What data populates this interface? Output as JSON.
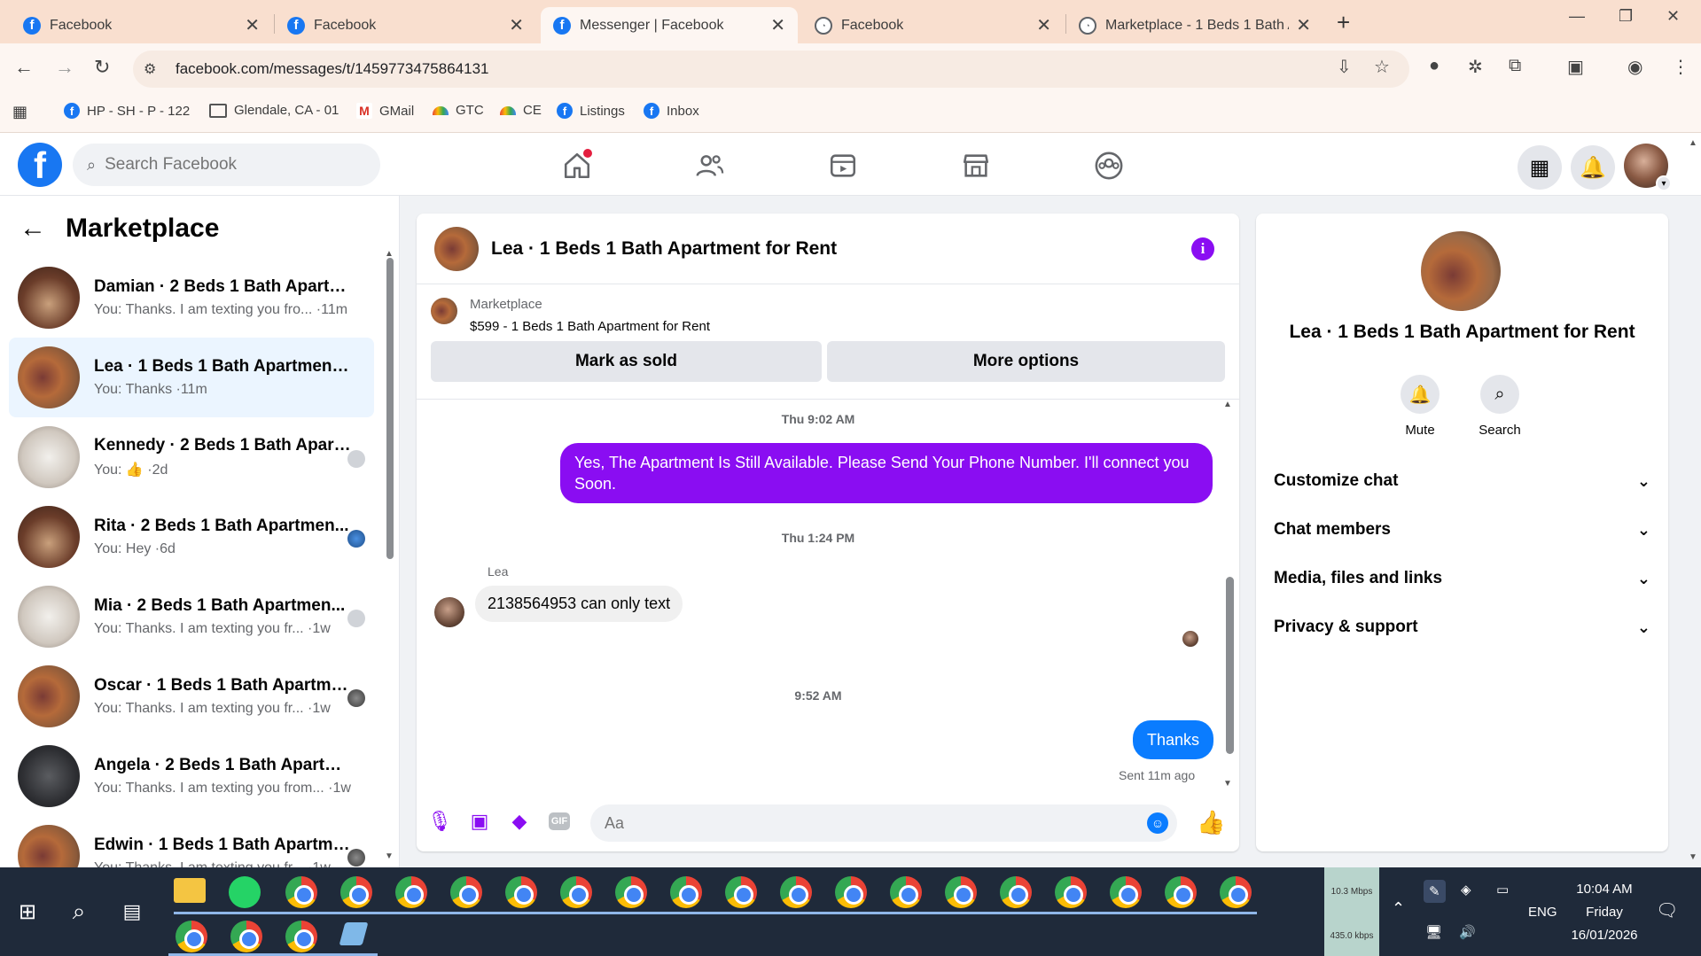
{
  "browser": {
    "tabs": [
      {
        "label": "Facebook",
        "icon": "facebook-icon"
      },
      {
        "label": "Facebook",
        "icon": "facebook-icon"
      },
      {
        "label": "Messenger | Facebook",
        "icon": "facebook-icon"
      },
      {
        "label": "Facebook",
        "icon": "loading-icon"
      },
      {
        "label": "Marketplace - 1 Beds 1 Bath Ap",
        "icon": "loading-icon"
      }
    ],
    "url": "facebook.com/messages/t/1459773475864131",
    "bookmarks": [
      {
        "label": "HP - SH - P - 122",
        "icon": "facebook-icon"
      },
      {
        "label": "Glendale, CA - 01",
        "icon": "folder-icon"
      },
      {
        "label": "GMail",
        "icon": "gmail-icon"
      },
      {
        "label": "GTC",
        "icon": "rainbow-icon"
      },
      {
        "label": "CE",
        "icon": "rainbow-icon"
      },
      {
        "label": "Listings",
        "icon": "facebook-icon"
      },
      {
        "label": "Inbox",
        "icon": "facebook-icon"
      }
    ]
  },
  "fb": {
    "search_placeholder": "Search Facebook",
    "brand_color": "#1877f2"
  },
  "left": {
    "title": "Marketplace",
    "conversations": [
      {
        "name": "Damian · 2 Beds 1 Bath Apartme...",
        "preview": "You: Thanks. I am texting you fro... ·11m"
      },
      {
        "name": "Lea · 1 Beds 1 Bath Apartment fo...",
        "preview": "You: Thanks ·11m"
      },
      {
        "name": "Kennedy · 2 Beds 1 Bath Apart...",
        "preview": "You: 👍 ·2d"
      },
      {
        "name": "Rita · 2 Beds 1 Bath Apartmen...",
        "preview": "You: Hey ·6d"
      },
      {
        "name": "Mia · 2 Beds 1 Bath Apartmen...",
        "preview": "You: Thanks. I am texting you fr... ·1w"
      },
      {
        "name": "Oscar · 1 Beds 1 Bath Apartme...",
        "preview": "You: Thanks. I am texting you fr... ·1w"
      },
      {
        "name": "Angela · 2 Beds 1 Bath Apartment",
        "preview": "You: Thanks. I am texting you from... ·1w"
      },
      {
        "name": "Edwin · 1 Beds 1 Bath Apartme...",
        "preview": "You: Thanks. I am texting you fr... ·1w"
      }
    ]
  },
  "chat": {
    "title": "Lea · 1 Beds 1 Bath Apartment for Rent",
    "marketplace_label": "Marketplace",
    "listing": "$599 - 1 Beds 1 Bath Apartment for Rent",
    "mark_sold": "Mark as sold",
    "more_options": "More options",
    "time1": "Thu 9:02 AM",
    "msg1": "Yes, The Apartment Is Still Available. Please Send Your Phone Number. I'll connect you Soon.",
    "time2": "Thu 1:24 PM",
    "sender": "Lea",
    "msg2": "2138564953 can only text",
    "time3": "9:52 AM",
    "msg3": "Thanks",
    "sent": "Sent 11m ago",
    "composer_placeholder": "Aa",
    "accent": "#8a0df2",
    "bubble_blue": "#0a7cff"
  },
  "right": {
    "title": "Lea · 1 Beds 1 Bath Apartment for Rent",
    "mute": "Mute",
    "search": "Search",
    "sections": [
      "Customize chat",
      "Chat members",
      "Media, files and links",
      "Privacy & support"
    ]
  },
  "taskbar": {
    "net_up": "10.3 Mbps",
    "net_down": "435.0 kbps",
    "lang": "ENG",
    "time": "10:04 AM",
    "day": "Friday",
    "date": "16/01/2026"
  }
}
